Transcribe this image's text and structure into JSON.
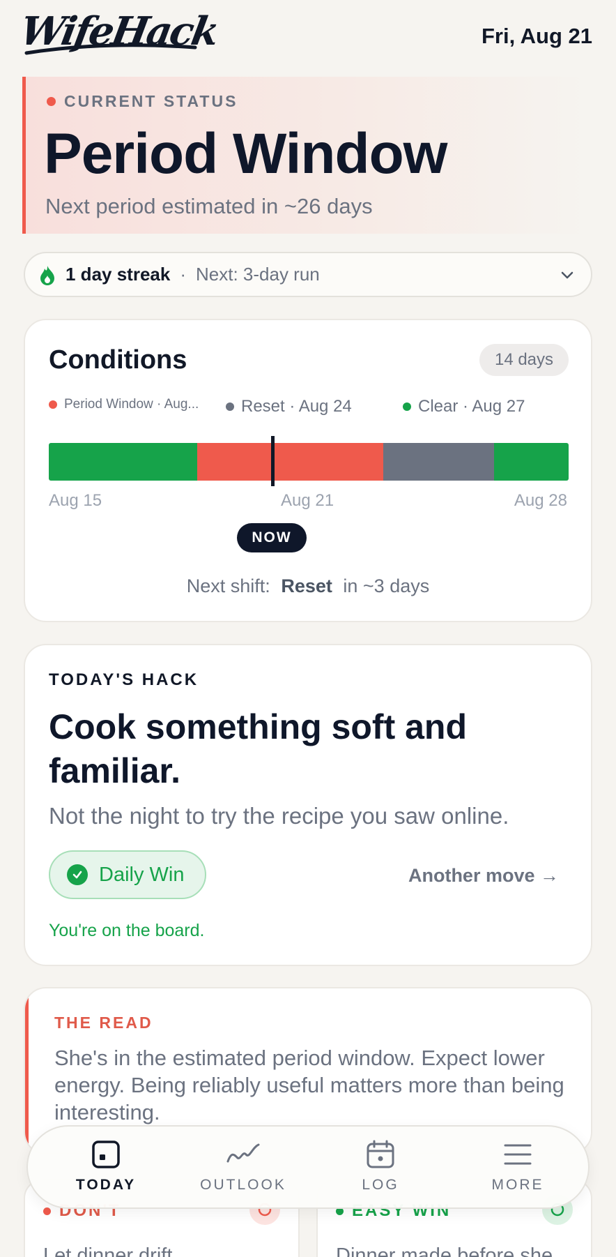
{
  "header": {
    "logo": "WifeHack",
    "date": "Fri, Aug 21"
  },
  "status": {
    "label": "CURRENT STATUS",
    "title": "Period Window",
    "subtitle": "Next period estimated in ~26 days",
    "accent": "#ef5a4c"
  },
  "streak": {
    "main": "1 day streak",
    "separator": "·",
    "next": "Next: 3-day run",
    "icon": "flame-icon"
  },
  "conditions": {
    "title": "Conditions",
    "range": "14 days",
    "legend": [
      {
        "label": "Period Window · Aug...",
        "color": "#ef5a4c"
      },
      {
        "label": "Reset · Aug 24",
        "color": "#6b7280"
      },
      {
        "label": "Clear · Aug 27",
        "color": "#16a34a"
      }
    ],
    "timeline": {
      "start": "Aug 15",
      "mid": "Aug 21",
      "end": "Aug 28",
      "segments": [
        {
          "state": "Clear",
          "color": "#16a34a",
          "from": 0.0,
          "to": 0.285
        },
        {
          "state": "Period Window",
          "color": "#ef5a4c",
          "from": 0.285,
          "to": 0.643
        },
        {
          "state": "Reset",
          "color": "#6b7280",
          "from": 0.643,
          "to": 0.857
        },
        {
          "state": "Clear",
          "color": "#16a34a",
          "from": 0.857,
          "to": 1.0
        }
      ],
      "now": 0.43
    },
    "now_label": "NOW",
    "next_shift": {
      "prefix": "Next shift:",
      "state": "Reset",
      "suffix": "in ~3 days"
    }
  },
  "hack": {
    "label": "TODAY'S HACK",
    "title": "Cook something soft and familiar.",
    "subtitle": "Not the night to try the recipe you saw online.",
    "win_label": "Daily Win",
    "another": "Another move →",
    "board": "You're on the board."
  },
  "read": {
    "label": "THE READ",
    "text": "She's in the estimated period window. Expect lower energy. Being reliably useful matters more than being interesting."
  },
  "dont": {
    "label": "DON'T",
    "text": "Let dinner drift"
  },
  "easy_win": {
    "label": "EASY WIN",
    "text": "Dinner made before she"
  },
  "nav": [
    {
      "label": "TODAY",
      "icon": "today-icon",
      "active": true
    },
    {
      "label": "OUTLOOK",
      "icon": "trend-icon",
      "active": false
    },
    {
      "label": "LOG",
      "icon": "calendar-icon",
      "active": false
    },
    {
      "label": "MORE",
      "icon": "menu-icon",
      "active": false
    }
  ]
}
